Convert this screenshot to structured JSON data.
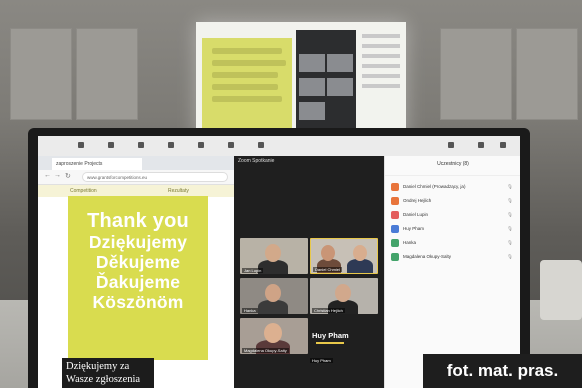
{
  "browser": {
    "tab_title": "zaproszenie Projects",
    "url": "www.grantsforcompetitions.eu",
    "nav_left": "Competition",
    "nav_right": "Rezultaty"
  },
  "slide": {
    "lines": [
      "Thank you",
      "Dziękujemy",
      "Děkujeme",
      "Ďakujeme",
      "Köszönöm"
    ],
    "caption": "Dziękujemy za Wasze zgłoszenia"
  },
  "meeting": {
    "title": "Zoom Spotkanie",
    "active_speaker": "Huy Pham",
    "tiles": [
      {
        "name": "Jan Lupin"
      },
      {
        "name": "Daniel Chmiel"
      },
      {
        "name": "Hanka"
      },
      {
        "name": "Christian Hejlich"
      },
      {
        "name": "Magdalena Okupy-Salty"
      },
      {
        "name": "Huy Pham"
      }
    ]
  },
  "participants": {
    "header": "Uczestnicy (8)",
    "items": [
      {
        "name": "Daniel Chmiel (Prowadzący, ja)",
        "color": "#e8743b"
      },
      {
        "name": "Ondrej Hejlich",
        "color": "#e8743b"
      },
      {
        "name": "Daniel Lupin",
        "color": "#e35d5d"
      },
      {
        "name": "Huy Pham",
        "color": "#4a7bd6"
      },
      {
        "name": "Hanka",
        "color": "#43a36a"
      },
      {
        "name": "Magdalena Okupy-Salty",
        "color": "#43a36a"
      }
    ]
  },
  "watermark": "fot. mat. pras."
}
